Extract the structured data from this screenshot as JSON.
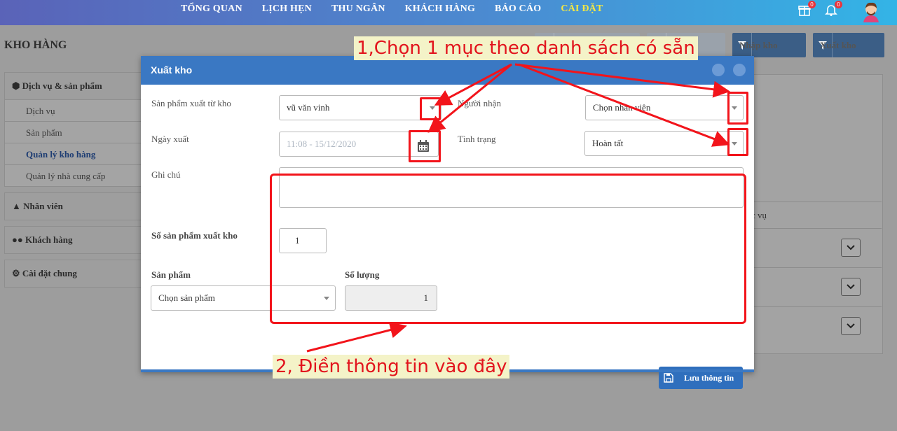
{
  "nav": {
    "items": [
      "TỔNG QUAN",
      "LỊCH HẸN",
      "THU NGÂN",
      "KHÁCH HÀNG",
      "BÁO CÁO",
      "CÀI ĐẶT"
    ],
    "active_index": 5,
    "gift_badge": "0",
    "bell_badge": "0"
  },
  "page": {
    "title": "KHO HÀNG",
    "buttons": [
      {
        "label": "Nhập kho",
        "icon": "filter-icon"
      },
      {
        "label": "Xuất kho",
        "icon": "filter-icon"
      }
    ]
  },
  "sidebar": {
    "groups": [
      {
        "label": "Dịch vụ & sản phẩm",
        "icon": "cube-icon",
        "items": [
          "Dịch vụ",
          "Sản phẩm",
          "Quản lý kho hàng",
          "Quản lý nhà cung cấp"
        ],
        "active": "Quản lý kho hàng"
      },
      {
        "label": "Nhân viên",
        "icon": "user-icon"
      },
      {
        "label": "Khách hàng",
        "icon": "users-icon"
      },
      {
        "label": "Cài đặt chung",
        "icon": "gear-icon"
      }
    ]
  },
  "background_table": {
    "header": "c vụ"
  },
  "modal": {
    "title": "Xuất kho",
    "source_label": "Sản phẩm xuất từ kho",
    "source_value": "vũ văn vinh",
    "recipient_label": "Người nhận",
    "recipient_value": "Chọn nhân viên",
    "date_label": "Ngày xuất",
    "date_value": "11:08 - 15/12/2020",
    "status_label": "Tình trạng",
    "status_value": "Hoàn tất",
    "note_label": "Ghi chú",
    "note_value": "",
    "count_label": "Số sản phẩm xuất kho",
    "count_value": "1",
    "product_label": "Sản phẩm",
    "product_value": "Chọn sản phẩm",
    "qty_label": "Số lượng",
    "qty_value": "1",
    "save_label": "Lưu thông tin"
  },
  "annotations": {
    "callout1": "1,Chọn 1 mục theo danh sách có sẵn",
    "callout2": "2, Điền thông tin vào đây",
    "color": "#f2141b",
    "callout_bg": "#f4f3c8"
  }
}
